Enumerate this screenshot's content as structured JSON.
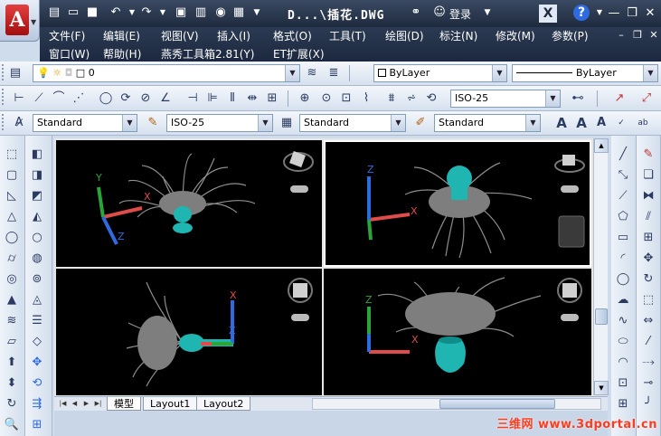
{
  "window": {
    "doc_title": "D...\\插花.DWG",
    "login_label": "登录",
    "controls": [
      "—",
      "❐",
      "✕"
    ]
  },
  "menu": {
    "row1": [
      "文件(F)",
      "编辑(E)",
      "视图(V)",
      "插入(I)",
      "格式(O)",
      "工具(T)",
      "绘图(D)",
      "标注(N)",
      "修改(M)",
      "参数(P)"
    ],
    "row2": [
      "窗口(W)",
      "帮助(H)",
      "燕秀工具箱2.81(Y)",
      "ET扩展(X)"
    ]
  },
  "layers": {
    "current_layer": "0",
    "color": "ByLayer",
    "linetype": "ByLayer"
  },
  "dimension_toolbar": {
    "dim_style": "ISO-25"
  },
  "styles_toolbar": {
    "text_style": "Standard",
    "dim_style": "ISO-25",
    "table_style": "Standard",
    "mleader_style": "Standard"
  },
  "viewports": [
    {
      "name": "top-left",
      "active": false
    },
    {
      "name": "top-right",
      "active": true
    },
    {
      "name": "bottom-left",
      "active": false
    },
    {
      "name": "bottom-right",
      "active": false
    }
  ],
  "axes": {
    "x": "X",
    "y": "Y",
    "z": "Z"
  },
  "layout_tabs": [
    "模型",
    "Layout1",
    "Layout2"
  ],
  "active_tab": "模型",
  "watermark": "三维网 www.3dportal.cn",
  "colors": {
    "title_bar": "#1e2a3e",
    "vase": "#1fb5b0",
    "flower": "#8e8e8e",
    "axis_x": "#e04b4b",
    "axis_y": "#2aa53a",
    "axis_z": "#2f6be0",
    "viewport_bg": "#000000",
    "watermark": "#ff3b1f"
  }
}
